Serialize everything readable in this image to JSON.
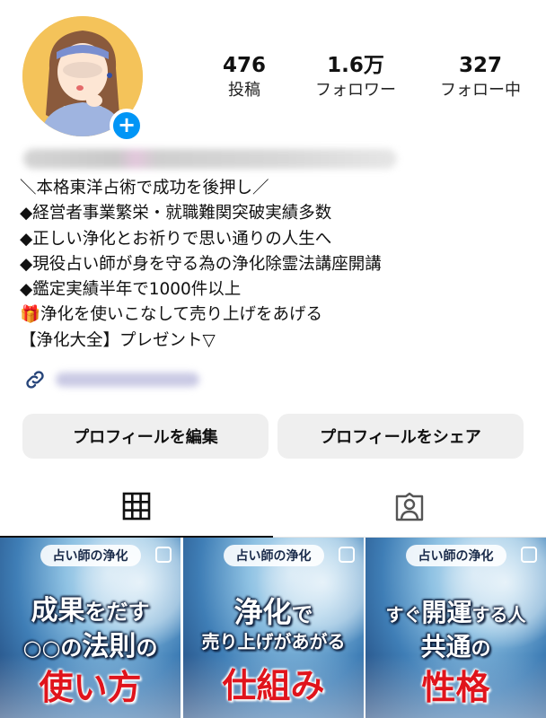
{
  "profile": {
    "stats": [
      {
        "value": "476",
        "label": "投稿"
      },
      {
        "value": "1.6万",
        "label": "フォロワー"
      },
      {
        "value": "327",
        "label": "フォロー中"
      }
    ],
    "add_badge": "+"
  },
  "bio": {
    "lines": [
      "＼本格東洋占術で成功を後押し／",
      "◆経営者事業繁栄・就職難関突破実績多数",
      "◆正しい浄化とお祈りで思い通りの人生へ",
      "◆現役占い師が身を守る為の浄化除霊法講座開講",
      "◆鑑定実績半年で1000件以上",
      "🎁浄化を使いこなして売り上げをあげる",
      "【浄化大全】プレゼント▽"
    ]
  },
  "buttons": {
    "edit": "プロフィールを編集",
    "share": "プロフィールをシェア"
  },
  "tabs": {
    "grid_icon": "grid-icon",
    "tagged_icon": "tagged-person-icon"
  },
  "posts": [
    {
      "tag": "占い師の浄化",
      "line1a": "成果",
      "line1b": "をだす",
      "line2a": "○○の",
      "line2b": "法則",
      "line2c": "の",
      "line3": "使い方"
    },
    {
      "tag": "占い師の浄化",
      "line1a": "浄化",
      "line1b": "で",
      "line2": "売り上げがあがる",
      "line3": "仕組み"
    },
    {
      "tag": "占い師の浄化",
      "line1a": "すぐ",
      "line1b": "開運",
      "line1c": "する人",
      "line2a": "共通",
      "line2b": "の",
      "line3": "性格"
    }
  ],
  "colors": {
    "accent_blue": "#0095f6",
    "button_bg": "#efefef",
    "headline_red": "#e0141c"
  }
}
